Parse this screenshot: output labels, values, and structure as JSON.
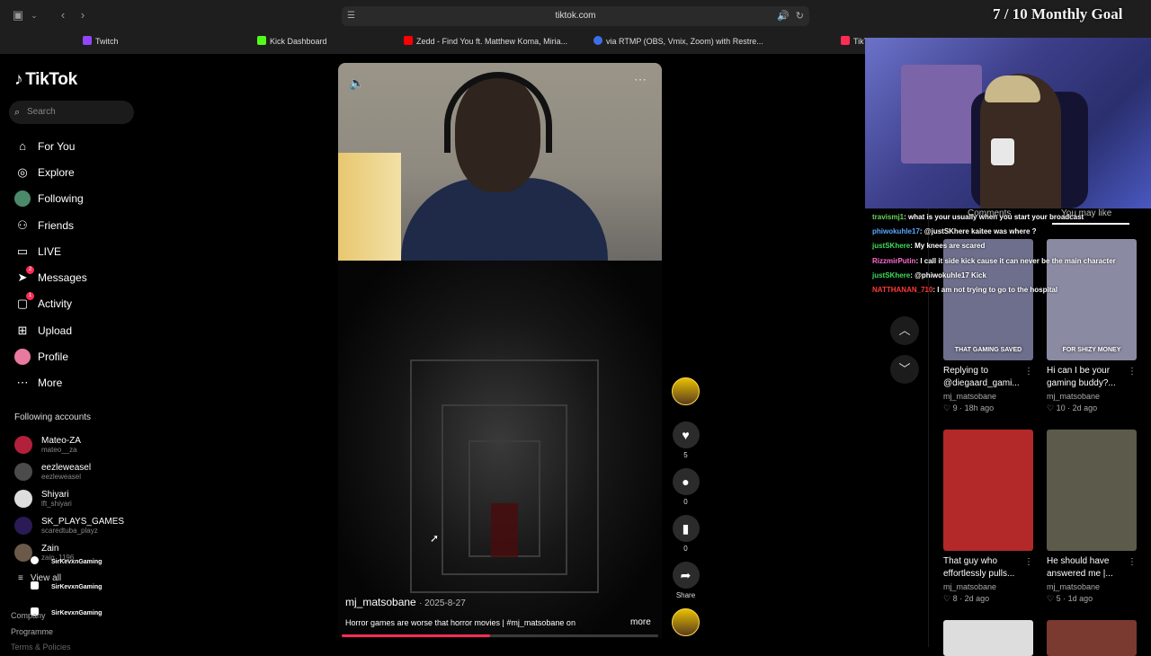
{
  "browser": {
    "url": "tiktok.com",
    "tabs": [
      {
        "label": "Twitch",
        "color": "#9146ff"
      },
      {
        "label": "Kick Dashboard",
        "color": "#53fc18"
      },
      {
        "label": "Zedd - Find You ft. Matthew Koma, Miria...",
        "color": "#ff0000"
      },
      {
        "label": "via RTMP (OBS, Vmix, Zoom) with Restre...",
        "color": "#3e6ee8"
      },
      {
        "label": "TikTok",
        "color": "#fe2c55"
      }
    ]
  },
  "stream_goal": "7 / 10 Monthly Goal",
  "sidebar": {
    "logo": "TikTok",
    "search_placeholder": "Search",
    "nav": [
      {
        "label": "For You",
        "icon": "home-icon"
      },
      {
        "label": "Explore",
        "icon": "compass-icon"
      },
      {
        "label": "Following",
        "icon": "avatar-icon"
      },
      {
        "label": "Friends",
        "icon": "friends-icon"
      },
      {
        "label": "LIVE",
        "icon": "live-tv-icon"
      },
      {
        "label": "Messages",
        "icon": "send-icon",
        "badge": "2"
      },
      {
        "label": "Activity",
        "icon": "activity-icon",
        "badge": "1"
      },
      {
        "label": "Upload",
        "icon": "upload-icon"
      },
      {
        "label": "Profile",
        "icon": "profile-avatar"
      },
      {
        "label": "More",
        "icon": "more-icon"
      }
    ],
    "following_title": "Following accounts",
    "following": [
      {
        "name": "Mateo-ZA",
        "user": "mateo__za",
        "color": "#b3203b"
      },
      {
        "name": "eezleweasel",
        "user": "eezleweasel",
        "color": "#4b4b4b"
      },
      {
        "name": "Shiyari",
        "user": "lft_shiyari",
        "color": "#ddd"
      },
      {
        "name": "SK_PLAYS_GAMES",
        "user": "scaredtuba_playz",
        "color": "#2a1a55"
      },
      {
        "name": "Zain",
        "user": "zain_1196",
        "color": "#6b5a4a"
      }
    ],
    "view_all": "View all",
    "stream_tags": [
      "SirKevxnGaming",
      "SirKevxnGaming",
      "SirKevxnGaming"
    ],
    "footer": [
      "Company",
      "Programme",
      "Terms & Policies"
    ]
  },
  "video": {
    "author": "mj_matsobane",
    "date": "2025-8-27",
    "description": "Horror games are worse that horror movies | #mj_matsobane on",
    "more_label": "more",
    "progress": 0.47,
    "likes": "5",
    "comments": "0",
    "saves": "0",
    "share_label": "Share"
  },
  "chat": [
    {
      "user": "travismj1",
      "color": "#6bd45b",
      "msg": ": what is your usually when you start your broadcast"
    },
    {
      "user": "phiwokuhle17",
      "color": "#5aa6ff",
      "msg": ": @justSKhere kaitee was where ?"
    },
    {
      "user": "justSKhere",
      "color": "#3ddc5b",
      "msg": ": My knees are scared"
    },
    {
      "user": "RizzmirPutin",
      "color": "#ff6bd0",
      "msg": ": I call it side kick cause it can never be the main character"
    },
    {
      "user": "justSKhere",
      "color": "#3ddc5b",
      "msg": ": @phiwokuhle17 Kick"
    },
    {
      "user": "NATTHANAN_710",
      "color": "#ff3a3a",
      "msg": ": I am not trying to go to the hospital"
    }
  ],
  "right_tabs": [
    "Comments",
    "You may like"
  ],
  "cards": [
    {
      "title": "Replying to @diegaard_gami...",
      "user": "mj_matsobane",
      "likes": "9",
      "age": "18h ago",
      "caption": "THAT GAMING SAVED",
      "color": "#6d6f8c"
    },
    {
      "title": "Hi can I be your gaming buddy?...",
      "user": "mj_matsobane",
      "likes": "10",
      "age": "2d ago",
      "caption": "FOR SHIZY MONEY",
      "color": "#8a8aa2"
    },
    {
      "title": "That guy who effortlessly pulls...",
      "user": "mj_matsobane",
      "likes": "8",
      "age": "2d ago",
      "caption": "",
      "color": "#b32828"
    },
    {
      "title": "He should have answered me |...",
      "user": "mj_matsobane",
      "likes": "5",
      "age": "1d ago",
      "caption": "",
      "color": "#5c5a4a"
    }
  ]
}
